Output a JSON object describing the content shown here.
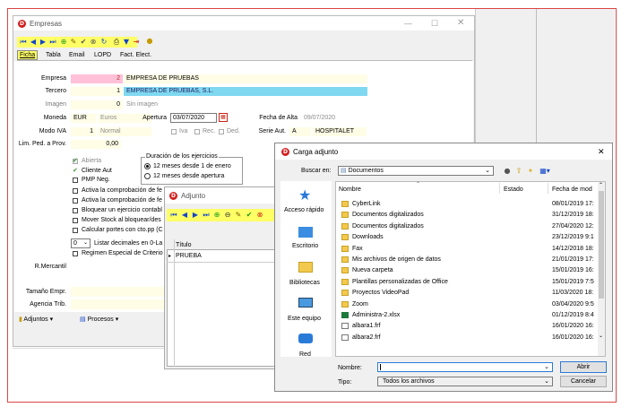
{
  "empresas": {
    "title": "Empresas",
    "tabs": [
      "Ficha",
      "Tabla",
      "Email",
      "LOPD",
      "Fact. Elect."
    ],
    "labels": {
      "empresa": "Empresa",
      "tercero": "Tercero",
      "imagen": "Imagen",
      "moneda": "Moneda",
      "modo_iva": "Modo IVA",
      "lim_ped": "Lim. Ped. a Prov.",
      "apertura": "Apertura",
      "fecha_alta": "Fecha de Alta",
      "serie_aut": "Serie Aut.",
      "mercantil": "R.Mercantil",
      "tamano": "Tamaño Empr.",
      "agencia": "Agencia Trib."
    },
    "values": {
      "empresa_num": "2",
      "empresa_name": "EMPRESA DE PRUEBAS",
      "tercero_num": "1",
      "tercero_name": "EMPRESA DE PRUEBAS, S.L.",
      "imagen_num": "0",
      "imagen_text": "Sin imagen",
      "moneda_code": "EUR",
      "moneda_name": "Euros",
      "modo_iva_num": "1",
      "modo_iva_name": "Normal",
      "lim_ped": "0,00",
      "apertura": "03/07/2020",
      "fecha_alta": "09/07/2020",
      "serie_aut": "A",
      "serie_name": "HOSPITALET",
      "decimales": "0"
    },
    "checks": {
      "iva": "Iva",
      "rec": "Rec.",
      "ded": "Ded.",
      "abierta": "Abierta",
      "cliente_aut": "Cliente Aut",
      "pmp_neg": "PMP Neg.",
      "activa1": "Activa la comprobación de fe",
      "activa2": "Activa la comprobación de fe",
      "bloquear": "Bloquear un ejercicio contabl",
      "mover_stock": "Mover Stock al bloquear/des",
      "calcular": "Calcular portes con cto.pp (C",
      "listar": "Listar decimales en 0-La",
      "regimen": "Regimen Especial de Criterio"
    },
    "duracion": {
      "title": "Duración de los ejercicios",
      "opt1": "12 meses desde 1 de enero",
      "opt2": "12 meses desde apertura"
    },
    "bottom_tabs": {
      "adjuntos": "Adjuntos",
      "procesos": "Procesos"
    }
  },
  "adjunto": {
    "title": "Adjunto",
    "col_titulo": "Título",
    "row1": "PRUEBA"
  },
  "carga": {
    "title": "Carga adjunto",
    "buscar_label": "Buscar en:",
    "buscar_value": "Documentos",
    "places": [
      "Acceso rápido",
      "Escritorio",
      "Bibliotecas",
      "Este equipo",
      "Red"
    ],
    "columns": {
      "nombre": "Nombre",
      "estado": "Estado",
      "fecha": "Fecha de mod"
    },
    "files": [
      {
        "name": "CyberLink",
        "date": "08/01/2019 17:",
        "type": "folder"
      },
      {
        "name": "Documentos digitalizados",
        "date": "31/12/2019 18:",
        "type": "folder"
      },
      {
        "name": "Documentos digitalizados",
        "date": "27/04/2020 12:",
        "type": "folder"
      },
      {
        "name": "Downloads",
        "date": "23/12/2019 9:1",
        "type": "folder"
      },
      {
        "name": "Fax",
        "date": "14/12/2018 18:",
        "type": "folder"
      },
      {
        "name": "Mis archivos de origen de datos",
        "date": "21/01/2019 17:",
        "type": "folder"
      },
      {
        "name": "Nueva carpeta",
        "date": "15/01/2019 16:",
        "type": "folder"
      },
      {
        "name": "Plantillas personalizadas de Office",
        "date": "15/01/2019 7:5",
        "type": "folder"
      },
      {
        "name": "Proyectos VideoPad",
        "date": "11/03/2020 18:",
        "type": "folder"
      },
      {
        "name": "Zoom",
        "date": "03/04/2020 9:5",
        "type": "folder"
      },
      {
        "name": "Administra-2.xlsx",
        "date": "01/12/2019 8:4",
        "type": "xlsx"
      },
      {
        "name": "albara1.frf",
        "date": "16/01/2020 16:",
        "type": "file"
      },
      {
        "name": "albara2.frf",
        "date": "16/01/2020 16:",
        "type": "file"
      }
    ],
    "nombre_label": "Nombre:",
    "tipo_label": "Tipo:",
    "tipo_value": "Todos los archivos",
    "abrir": "Abrir",
    "cancelar": "Cancelar"
  }
}
